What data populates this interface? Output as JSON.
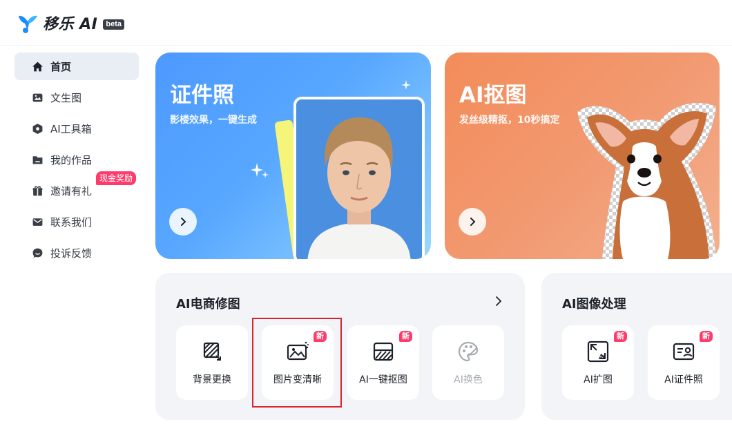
{
  "header": {
    "logo_text": "移乐 AI",
    "badge": "beta"
  },
  "sidebar": {
    "items": [
      {
        "label": "首页",
        "icon": "home-icon",
        "active": true
      },
      {
        "label": "文生图",
        "icon": "image-icon"
      },
      {
        "label": "AI工具箱",
        "icon": "toolbox-icon"
      },
      {
        "label": "我的作品",
        "icon": "folder-icon"
      },
      {
        "label": "邀请有礼",
        "icon": "gift-icon",
        "badge": "现金奖励"
      },
      {
        "label": "联系我们",
        "icon": "mail-icon"
      },
      {
        "label": "投诉反馈",
        "icon": "feedback-icon"
      }
    ]
  },
  "banners": [
    {
      "title": "证件照",
      "subtitle": "影楼效果，一键生成"
    },
    {
      "title": "AI抠图",
      "subtitle": "发丝级精抠，10秒搞定"
    }
  ],
  "sections": {
    "ecommerce": {
      "title": "AI电商修图",
      "tools": [
        {
          "label": "背景更换",
          "icon": "background-replace-icon",
          "new": false
        },
        {
          "label": "图片变清晰",
          "icon": "image-enhance-icon",
          "new": true,
          "badge": "新"
        },
        {
          "label": "AI一键抠图",
          "icon": "cutout-icon",
          "new": true,
          "badge": "新"
        },
        {
          "label": "AI换色",
          "icon": "palette-icon",
          "new": false,
          "disabled": true
        }
      ]
    },
    "image_processing": {
      "title": "AI图像处理",
      "tools": [
        {
          "label": "AI扩图",
          "icon": "expand-icon",
          "new": true,
          "badge": "新"
        },
        {
          "label": "AI证件照",
          "icon": "id-card-icon",
          "new": true,
          "badge": "新"
        }
      ]
    }
  },
  "colors": {
    "accent_badge": "#ff3b6b",
    "highlight_box": "#d9252f",
    "logo_blue": "#1a8cff"
  }
}
